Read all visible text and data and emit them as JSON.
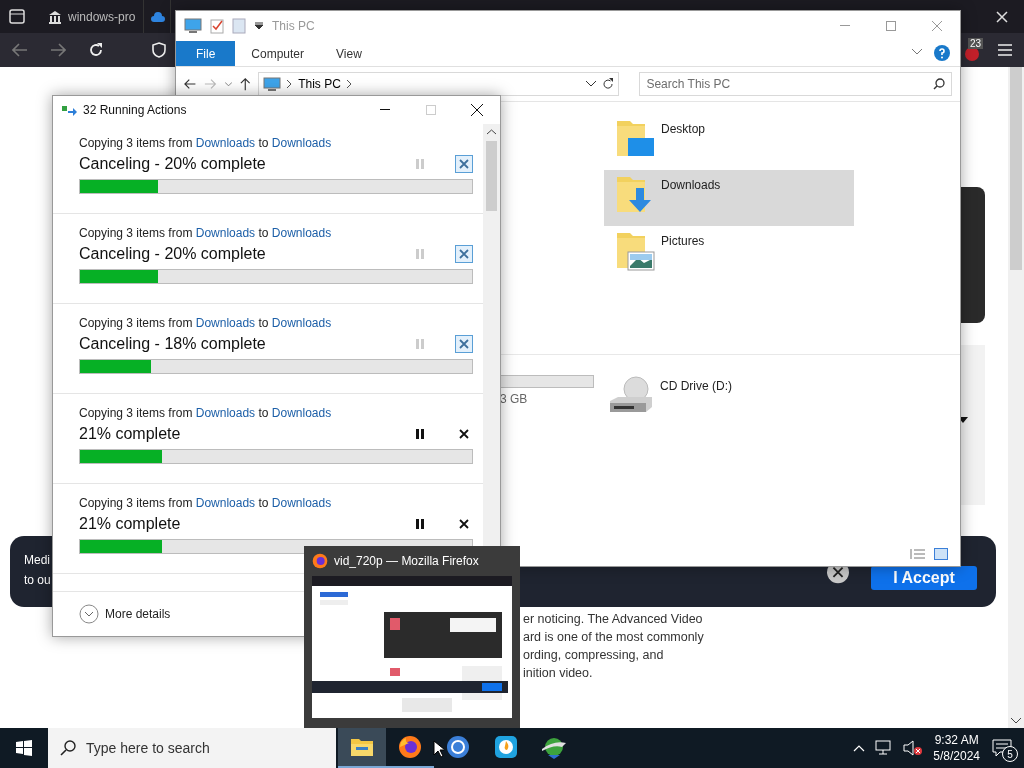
{
  "browser": {
    "tabs": [
      {
        "title": "windows-pro",
        "kind": "bank"
      },
      {
        "kind": "cloud"
      }
    ],
    "badge": "23",
    "page": {
      "banner_lines": [
        "Medi",
        "to ou"
      ],
      "accept": "I Accept",
      "article_lines": [
        "er noticing. The Advanced Video",
        "ard is one of the most commonly",
        "ording, compressing, and",
        "inition video."
      ]
    }
  },
  "explorer": {
    "title": "This PC",
    "ribbon_tabs": [
      {
        "label": "File",
        "selected": true
      },
      {
        "label": "Computer",
        "selected": false
      },
      {
        "label": "View",
        "selected": false
      }
    ],
    "address": "This PC",
    "search": {
      "placeholder": "Search This PC"
    },
    "folders": [
      {
        "name": "Desktop",
        "kind": "desktop",
        "selected": false
      },
      {
        "name": "Downloads",
        "kind": "downloads",
        "selected": true
      },
      {
        "name": "Pictures",
        "kind": "pictures",
        "selected": false
      }
    ],
    "drive_size": "3 GB",
    "devices": [
      {
        "name": "CD Drive (D:)"
      }
    ]
  },
  "progress_dialog": {
    "title": "32 Running Actions",
    "operations": [
      {
        "text": "Copying 3 items from",
        "from": "Downloads",
        "joiner": "to",
        "to": "Downloads",
        "status": "Canceling - 20% complete",
        "level": 0.2,
        "canceling": true
      },
      {
        "text": "Copying 3 items from",
        "from": "Downloads",
        "joiner": "to",
        "to": "Downloads",
        "status": "Canceling - 20% complete",
        "level": 0.2,
        "canceling": true
      },
      {
        "text": "Copying 3 items from",
        "from": "Downloads",
        "joiner": "to",
        "to": "Downloads",
        "status": "Canceling - 18% complete",
        "level": 0.18,
        "canceling": true
      },
      {
        "text": "Copying 3 items from",
        "from": "Downloads",
        "joiner": "to",
        "to": "Downloads",
        "status": "21% complete",
        "level": 0.21,
        "canceling": false
      },
      {
        "text": "Copying 3 items from",
        "from": "Downloads",
        "joiner": "to",
        "to": "Downloads",
        "status": "21% complete",
        "level": 0.21,
        "canceling": false
      }
    ],
    "footer": "More details"
  },
  "taskbar_preview": {
    "title": "vid_720p — Mozilla Firefox"
  },
  "taskbar": {
    "search": {
      "placeholder": "Type here to search"
    },
    "apps": [
      {
        "kind": "explorer",
        "running": true,
        "active": true
      },
      {
        "kind": "firefox",
        "running": true,
        "active": false
      },
      {
        "kind": "chrome",
        "running": false,
        "active": false
      },
      {
        "kind": "flame",
        "running": false,
        "active": false
      },
      {
        "kind": "globe",
        "running": false,
        "active": false
      }
    ],
    "time": "9:32 AM",
    "date": "5/8/2024",
    "notifications": "5"
  }
}
